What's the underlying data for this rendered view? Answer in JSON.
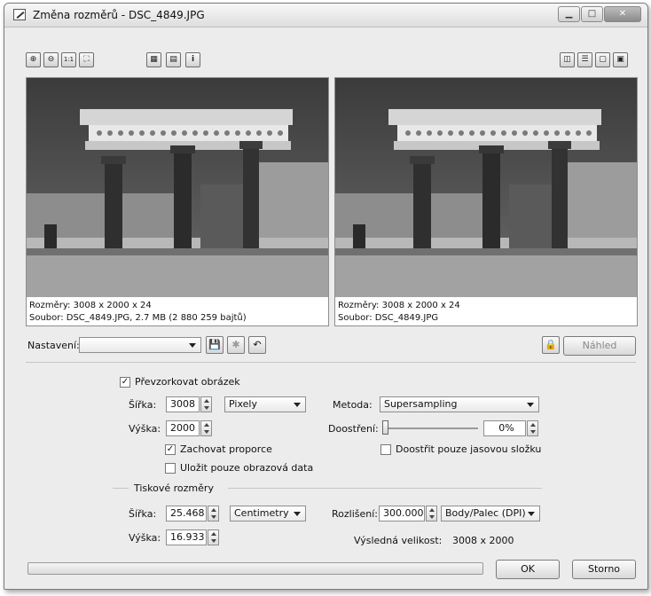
{
  "window": {
    "title": "Změna rozměrů - DSC_4849.JPG"
  },
  "toolbar": {
    "zoom_in": "⊕",
    "zoom_out": "⊖",
    "zoom_100": "1:1",
    "zoom_fit": "⛶",
    "histogram": "▦",
    "levels": "▤",
    "info": "i"
  },
  "left_panel": {
    "size_line": "Rozměry: 3008 x 2000 x 24",
    "file_line": "Soubor: DSC_4849.JPG, 2.7 MB (2 880 259 bajtů)"
  },
  "right_panel": {
    "size_line": "Rozměry: 3008 x 2000 x 24",
    "file_line": "Soubor: DSC_4849.JPG"
  },
  "settings": {
    "label": "Nastavení:",
    "value": "",
    "preview_label": "Náhled"
  },
  "resample": {
    "checkbox_label": "Převzorkovat obrázek",
    "width_label": "Šířka:",
    "width_value": "3008",
    "height_label": "Výška:",
    "height_value": "2000",
    "unit": "Pixely",
    "keep_ratio_label": "Zachovat proporce",
    "save_data_label": "Uložit pouze obrazová data",
    "method_label": "Metoda:",
    "method_value": "Supersampling",
    "sharpen_label": "Doostření:",
    "sharpen_value": "0%",
    "sharpen_luma_label": "Doostřit pouze jasovou složku"
  },
  "print": {
    "group_label": "Tiskové rozměry",
    "width_label": "Šířka:",
    "width_value": "25.468",
    "height_label": "Výška:",
    "height_value": "16.933",
    "unit": "Centimetry",
    "resolution_label": "Rozlišení:",
    "resolution_value": "300.000",
    "resolution_unit": "Body/Palec (DPI)",
    "result_label": "Výsledná velikost:",
    "result_value": "3008 x 2000"
  },
  "footer": {
    "ok": "OK",
    "cancel": "Storno"
  }
}
